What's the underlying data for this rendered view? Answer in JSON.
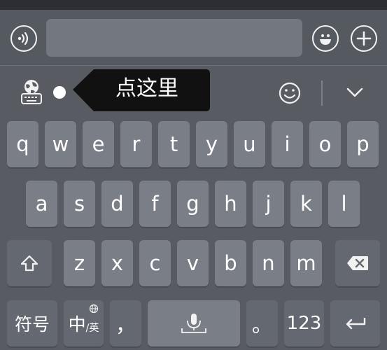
{
  "chat_bar": {
    "voice_icon": "voice-icon",
    "emoji_icon": "emoji-icon",
    "plus_icon": "plus-icon"
  },
  "toolbar": {
    "keyboard_icon": "globe-keyboard-icon",
    "tooltip_text": "点这里",
    "smiley_icon": "smiley-icon",
    "collapse_icon": "chevron-down-icon"
  },
  "keys": {
    "row1": [
      "q",
      "w",
      "e",
      "r",
      "t",
      "y",
      "u",
      "i",
      "o",
      "p"
    ],
    "row2": [
      "a",
      "s",
      "d",
      "f",
      "g",
      "h",
      "j",
      "k",
      "l"
    ],
    "row3": [
      "z",
      "x",
      "c",
      "v",
      "b",
      "n",
      "m"
    ],
    "symbols": "符号",
    "lang_main": "中",
    "lang_sub": "/英",
    "comma": "，",
    "period": "。",
    "numbers": "123"
  },
  "colors": {
    "keyboard_bg": "#585b61",
    "key_bg": "#7a7e86",
    "function_key_bg": "#646870",
    "tooltip_bg": "#111111"
  }
}
